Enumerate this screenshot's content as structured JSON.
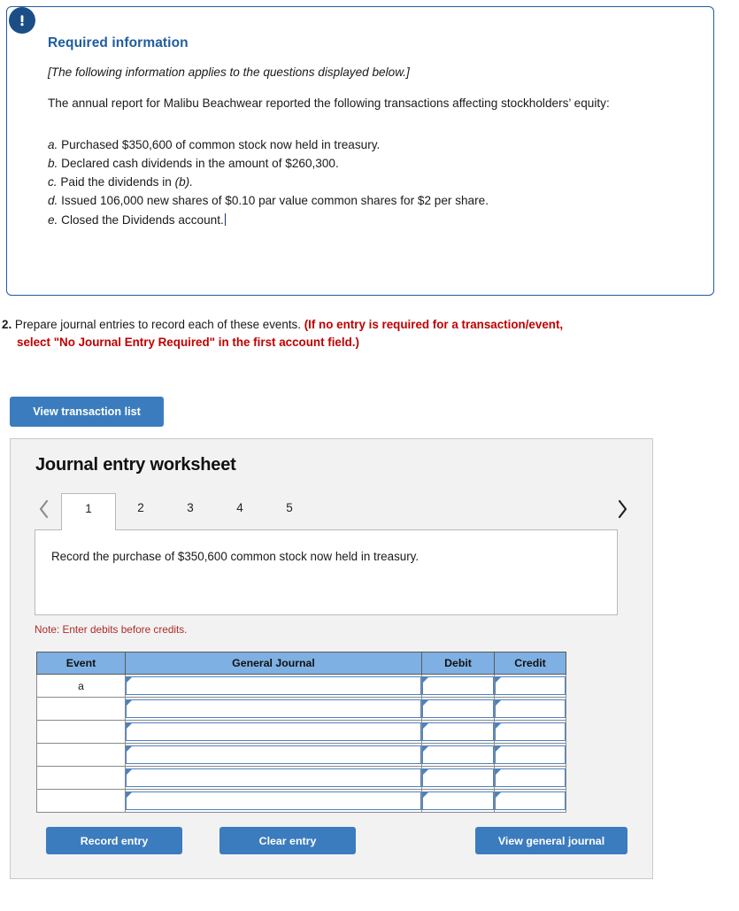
{
  "required_info": {
    "icon": "exclamation-circle-icon",
    "title": "Required information",
    "applies_note": "[The following information applies to the questions displayed below.]",
    "intro": "The annual report for Malibu Beachwear reported the following transactions affecting stockholders’ equity:",
    "transactions": [
      {
        "label": "a.",
        "text_before": " Purchased $350,600 of common stock now held in treasury.",
        "italic_tail": ""
      },
      {
        "label": "b.",
        "text_before": " Declared cash dividends in the amount of $260,300.",
        "italic_tail": ""
      },
      {
        "label": "c.",
        "text_before": " Paid the dividends in ",
        "italic_tail": "(b)."
      },
      {
        "label": "d.",
        "text_before": " Issued 106,000 new shares of $0.10 par value common shares for $2 per share.",
        "italic_tail": ""
      },
      {
        "label": "e.",
        "text_before": " Closed the Dividends account.",
        "italic_tail": ""
      }
    ]
  },
  "question": {
    "number": "2.",
    "prompt": "Prepare journal entries to record each of these events.",
    "red_line1": "(If no entry is required for a transaction/event,",
    "red_line2": "select \"No Journal Entry Required\" in the first account field.)"
  },
  "buttons": {
    "view_transaction_list": "View transaction list",
    "record_entry": "Record entry",
    "clear_entry": "Clear entry",
    "view_general_journal": "View general journal"
  },
  "worksheet": {
    "title": "Journal entry worksheet",
    "prev_icon": "chevron-left-icon",
    "next_icon": "chevron-right-icon",
    "tabs": [
      {
        "label": "1",
        "active": true
      },
      {
        "label": "2",
        "active": false
      },
      {
        "label": "3",
        "active": false
      },
      {
        "label": "4",
        "active": false
      },
      {
        "label": "5",
        "active": false
      }
    ],
    "active_tab_text": "Record the purchase of $350,600 common stock now held in treasury.",
    "note": "Note: Enter debits before credits.",
    "table": {
      "headers": [
        "Event",
        "General Journal",
        "Debit",
        "Credit"
      ],
      "rows": [
        {
          "event": "a",
          "general_journal": "",
          "debit": "",
          "credit": ""
        },
        {
          "event": "",
          "general_journal": "",
          "debit": "",
          "credit": ""
        },
        {
          "event": "",
          "general_journal": "",
          "debit": "",
          "credit": ""
        },
        {
          "event": "",
          "general_journal": "",
          "debit": "",
          "credit": ""
        },
        {
          "event": "",
          "general_journal": "",
          "debit": "",
          "credit": ""
        },
        {
          "event": "",
          "general_journal": "",
          "debit": "",
          "credit": ""
        }
      ]
    }
  },
  "colors": {
    "panel_border_blue": "#1f5c9e",
    "icon_navy": "#1b4e87",
    "button_blue": "#3b7cbe",
    "table_header_blue": "#7eb0e3",
    "input_border_blue": "#4e82bd",
    "alert_red": "#c00000",
    "note_red": "#b02a2a",
    "panel_gray": "#f2f2f2"
  }
}
